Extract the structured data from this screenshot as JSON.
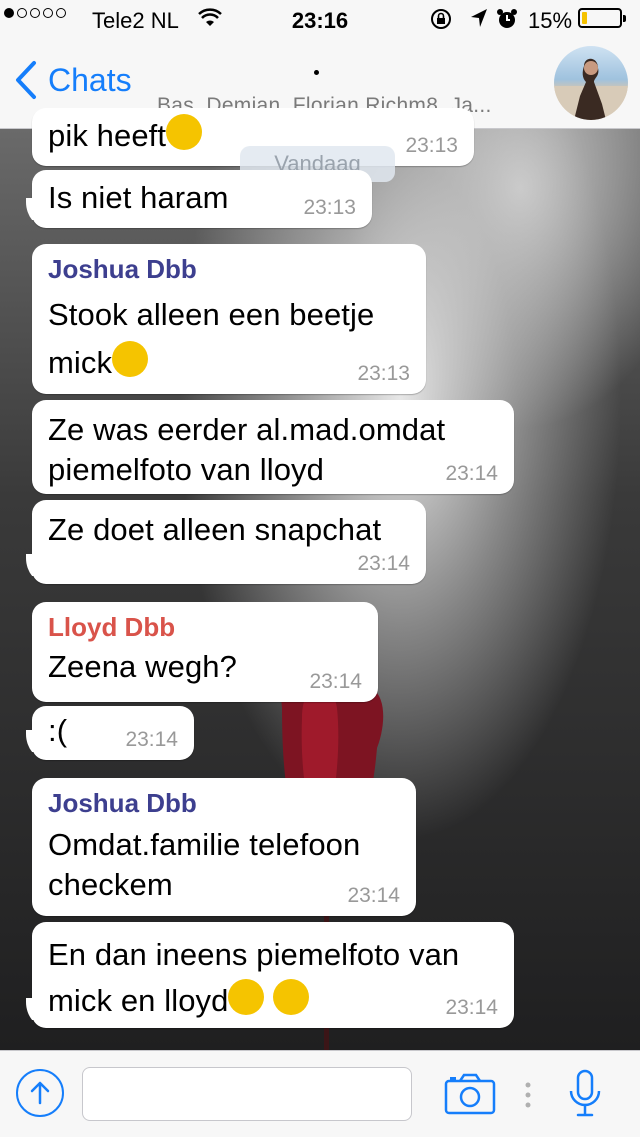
{
  "status_bar": {
    "carrier": "Tele2 NL",
    "time": "23:16",
    "battery": "15%",
    "battery_level": 0.15,
    "signal_bars_filled": 1,
    "signal_bars_total": 5
  },
  "nav": {
    "back_label": "Chats",
    "members": "Bas, Demian, Florian Richm8, Ja..."
  },
  "date_label": "Vandaag",
  "messages": [
    {
      "sender": "",
      "text": "pik heeft",
      "emoji": "crying-laughing",
      "time": "23:13"
    },
    {
      "sender": "",
      "text": "Is niet haram",
      "time": "23:13"
    },
    {
      "sender": "Joshua Dbb",
      "text": "Stook alleen een beetje mick",
      "emoji": "kissing-face",
      "time": "23:13"
    },
    {
      "sender": "",
      "text": "Ze was eerder al.mad.omdat piemelfoto van lloyd",
      "time": "23:14"
    },
    {
      "sender": "",
      "text": "Ze doet alleen snapchat",
      "time": "23:14"
    },
    {
      "sender": "Lloyd Dbb",
      "text": "Zeena wegh?",
      "time": "23:14"
    },
    {
      "sender": "",
      "text": ":(",
      "time": "23:14"
    },
    {
      "sender": "Joshua Dbb",
      "text": "Omdat.familie telefoon checkem",
      "time": "23:14"
    },
    {
      "sender": "",
      "text": "En dan ineens piemelfoto van mick en lloyd",
      "emoji": "crying-laughing x2",
      "time": "23:14"
    }
  ],
  "colors": {
    "accent": "#157efb",
    "joshua": "#3d3f8f",
    "lloyd": "#d9534a",
    "bubble": "#ffffff",
    "timestamp": "#999999"
  },
  "icons": [
    "wifi-icon",
    "lock-icon",
    "location-icon",
    "alarm-icon",
    "battery-icon",
    "back-chevron-icon",
    "attach-icon",
    "camera-icon",
    "more-icon",
    "mic-icon"
  ]
}
